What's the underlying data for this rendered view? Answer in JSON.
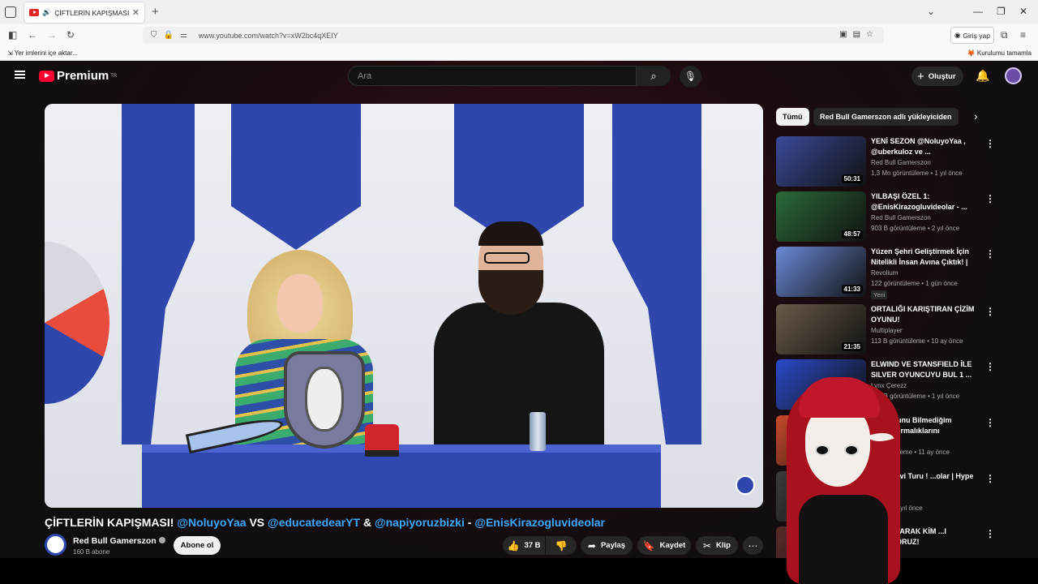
{
  "browser": {
    "tab_title": "ÇİFTLERİN KAPIŞMASI! @N",
    "url": "www.youtube.com/watch?v=xW2bc4qXEIY",
    "login_label": "Giriş yap",
    "bookmark_import": "Yer imlerini içe aktar...",
    "bookmark_right": "Kurulumu tamamla"
  },
  "youtube": {
    "logo_text": "Premium",
    "logo_country": "TR",
    "search_placeholder": "Ara",
    "create_label": "Oluştur"
  },
  "video": {
    "title_prefix": "ÇİFTLERİN KAPIŞMASI! ",
    "mention1": "@NoluyoYaa",
    "vs": " VS ",
    "mention2": "@educatedearYT",
    "amp": " & ",
    "mention3": "@napiyoruzbizki",
    "dash": " - ",
    "mention4": "@EnisKirazogluvideolar",
    "channel": "Red Bull Gamerszon",
    "subscribers": "160 B abone",
    "subscribe_label": "Abone ol",
    "likes": "37 B",
    "share_label": "Paylaş",
    "save_label": "Kaydet",
    "clip_label": "Klip"
  },
  "sidebar": {
    "chips": [
      "Tümü",
      "Red Bull Gamerszon adlı yükleyiciden"
    ],
    "recommendations": [
      {
        "title": "YENİ SEZON @NoluyoYaa , @uberkuloz ve ...",
        "channel": "Red Bull Gamerszon",
        "meta": "1,3 Mn görüntüleme • 1 yıl önce",
        "duration": "50:31",
        "color": "#3a4a9a"
      },
      {
        "title": "YILBAŞI ÖZEL 1: @EnisKirazogluvideolar - ...",
        "channel": "Red Bull Gamerszon",
        "meta": "903 B görüntüleme • 2 yıl önce",
        "duration": "48:57",
        "color": "#2a6a3a"
      },
      {
        "title": "Yüzen Şehri Geliştirmek İçin Nitelikli İnsan Avına Çıktık! | ...",
        "channel": "Revolium",
        "meta": "122 görüntüleme • 1 gün önce",
        "duration": "41:33",
        "color": "#6a8ad8",
        "badge": "Yeni"
      },
      {
        "title": "ORTALIĞI KARIŞTIRAN ÇİZİM OYUNU!",
        "channel": "Multiplayer",
        "meta": "113 B görüntüleme • 10 ay önce",
        "duration": "21:35",
        "color": "#6a5a4a"
      },
      {
        "title": "ELWIND VE STANSFIELD İLE SILVER OYUNCUYU BUL 1 ...",
        "channel": "Lynx Çerezz",
        "meta": "274 B görüntüleme • 1 yıl önce",
        "duration": "",
        "color": "#2a4ac8"
      },
      {
        "title": "...olduğunu Bilmediğim Japon ...rmalıklarını Deniyorum",
        "channel": "...Arslan",
        "meta": "...görüntüleme • 11 ay önce",
        "duration": "",
        "color": "#c84a2a"
      },
      {
        "title": "...orku Evi Turu ! ...olar | Hype",
        "channel": "",
        "meta": "...eme • 3 yıl önce",
        "duration": "",
        "color": "#3a3a3a"
      },
      {
        "title": "...Y SORARAK KİM ...I BULUYORUZ!",
        "channel": "",
        "meta": "",
        "duration": "",
        "color": "#5a2a2a"
      }
    ]
  }
}
